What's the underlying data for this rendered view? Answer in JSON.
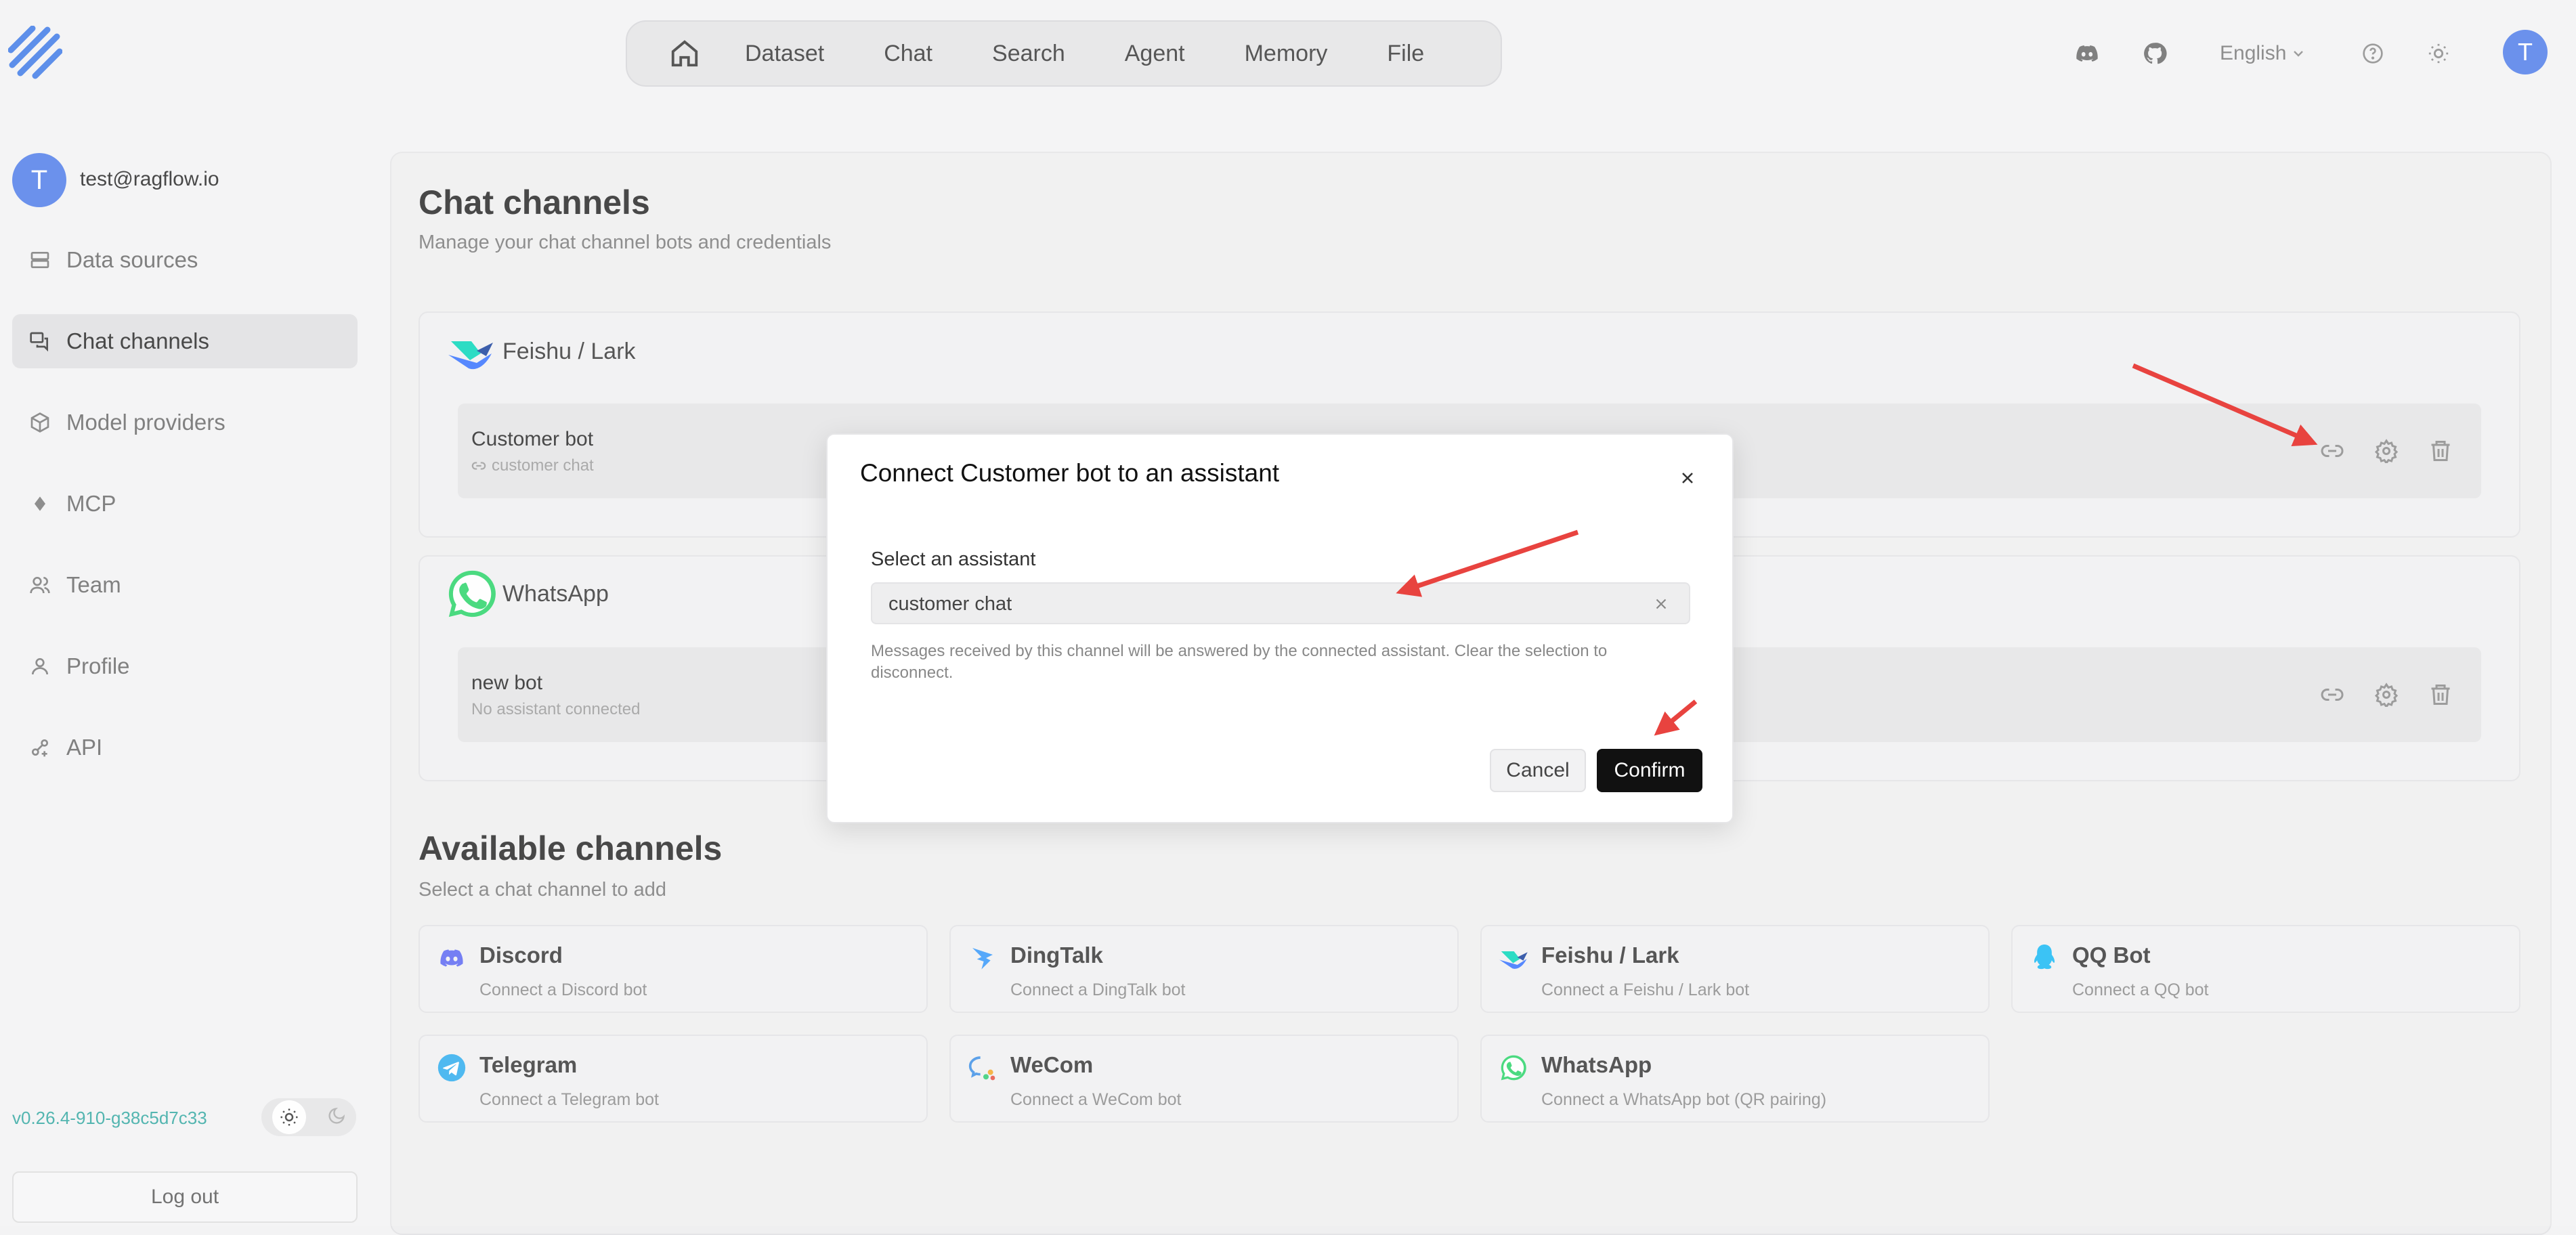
{
  "topnav": {
    "items": [
      "Dataset",
      "Chat",
      "Search",
      "Agent",
      "Memory",
      "File"
    ],
    "language": "English",
    "avatar_initial": "T"
  },
  "sidebar": {
    "avatar_initial": "T",
    "email": "test@ragflow.io",
    "items": [
      {
        "label": "Data sources",
        "icon": "database-icon"
      },
      {
        "label": "Chat channels",
        "icon": "chat-channels-icon"
      },
      {
        "label": "Model providers",
        "icon": "cube-icon"
      },
      {
        "label": "MCP",
        "icon": "mcp-icon"
      },
      {
        "label": "Team",
        "icon": "team-icon"
      },
      {
        "label": "Profile",
        "icon": "user-icon"
      },
      {
        "label": "API",
        "icon": "api-icon"
      }
    ],
    "version": "v0.26.4-910-g38c5d7c33",
    "logout_label": "Log out"
  },
  "main": {
    "title": "Chat channels",
    "subtitle": "Manage your chat channel bots and credentials",
    "connected": [
      {
        "channel": "Feishu / Lark",
        "bot": {
          "name": "Customer bot",
          "meta": "customer chat"
        }
      },
      {
        "channel": "WhatsApp",
        "bot": {
          "name": "new bot",
          "meta": "No assistant connected"
        }
      }
    ],
    "available_title": "Available channels",
    "available_subtitle": "Select a chat channel to add",
    "available": [
      {
        "name": "Discord",
        "desc": "Connect a Discord bot",
        "color": "#5865F2"
      },
      {
        "name": "DingTalk",
        "desc": "Connect a DingTalk bot",
        "color": "#3296fa"
      },
      {
        "name": "Feishu / Lark",
        "desc": "Connect a Feishu / Lark bot",
        "color": "#3370ff"
      },
      {
        "name": "QQ Bot",
        "desc": "Connect a QQ bot",
        "color": "#12b7f5"
      },
      {
        "name": "Telegram",
        "desc": "Connect a Telegram bot",
        "color": "#2AABEE"
      },
      {
        "name": "WeCom",
        "desc": "Connect a WeCom bot",
        "color": "#3a8ee6"
      },
      {
        "name": "WhatsApp",
        "desc": "Connect a WhatsApp bot (QR pairing)",
        "color": "#25D366"
      }
    ]
  },
  "modal": {
    "title": "Connect Customer bot to an assistant",
    "label": "Select an assistant",
    "selected": "customer chat",
    "help": "Messages received by this channel will be answered by the connected assistant. Clear the selection to disconnect.",
    "cancel_label": "Cancel",
    "confirm_label": "Confirm"
  },
  "colors": {
    "accent": "#4c7bea",
    "annotation_arrow": "#e8433f",
    "confirm_bg": "#111111"
  }
}
